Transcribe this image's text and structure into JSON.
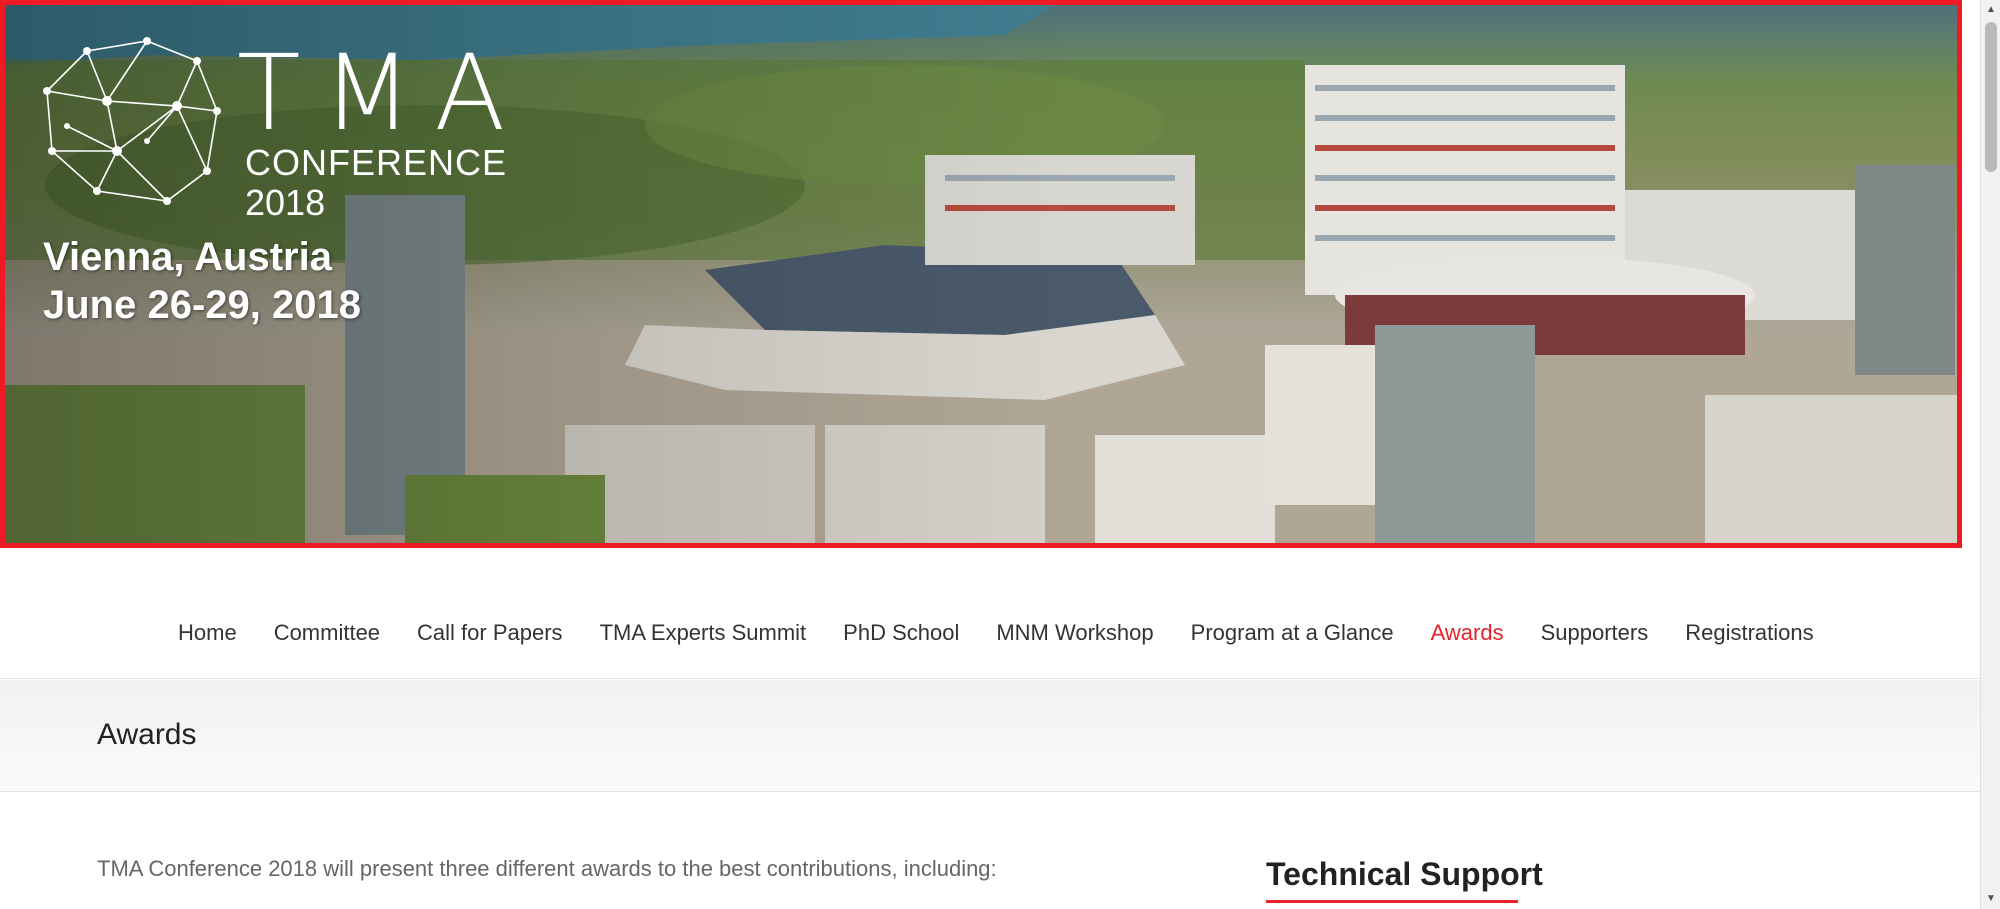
{
  "hero": {
    "logo_main": "TMA",
    "logo_sub": "CONFERENCE",
    "logo_year": "2018",
    "location": "Vienna, Austria",
    "dates": "June 26-29, 2018"
  },
  "nav": {
    "items": [
      {
        "label": "Home"
      },
      {
        "label": "Committee"
      },
      {
        "label": "Call for Papers"
      },
      {
        "label": "TMA Experts Summit"
      },
      {
        "label": "PhD School"
      },
      {
        "label": "MNM Workshop"
      },
      {
        "label": "Program at a Glance"
      },
      {
        "label": "Awards"
      },
      {
        "label": "Supporters"
      },
      {
        "label": "Registrations"
      }
    ],
    "active": "Awards"
  },
  "page": {
    "title": "Awards",
    "intro": "TMA Conference 2018 will present three different awards to the best contributions, including:"
  },
  "sidebar": {
    "widget_title": "Technical Support"
  },
  "colors": {
    "accent": "#e5232a",
    "text": "#333333",
    "muted": "#666666"
  }
}
